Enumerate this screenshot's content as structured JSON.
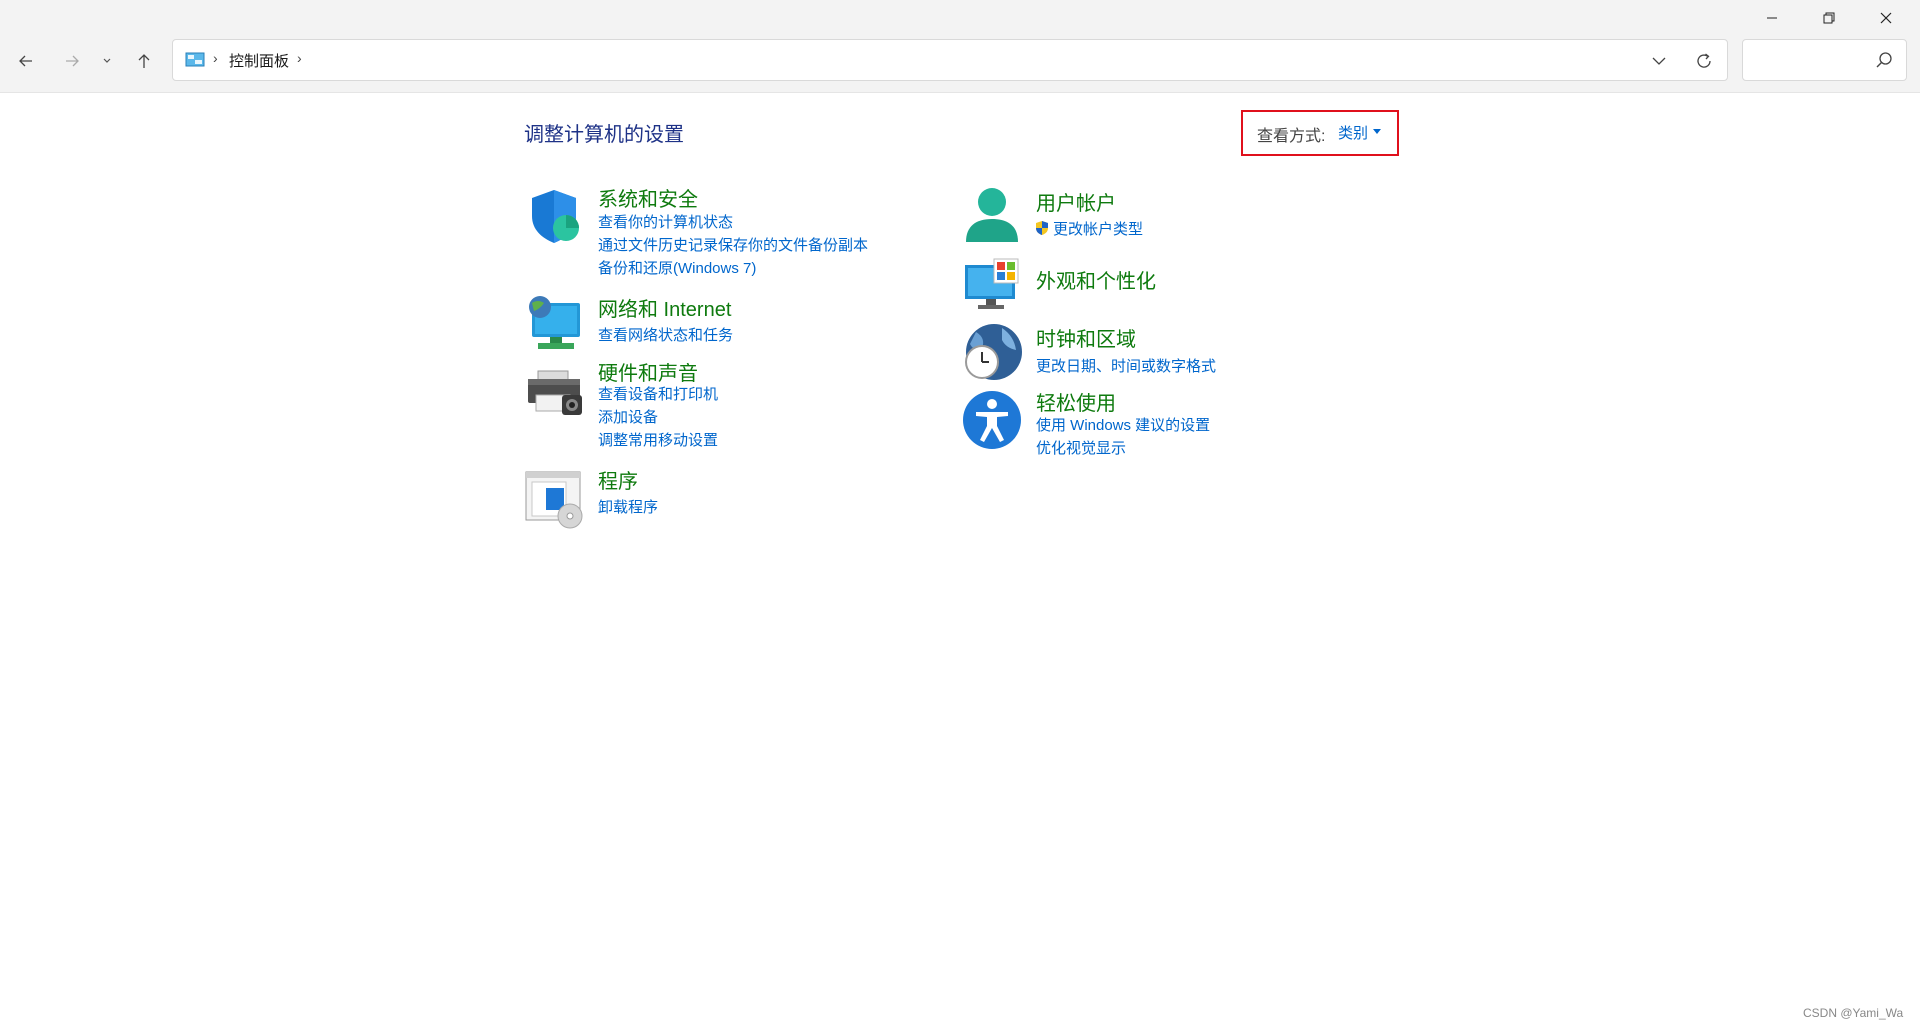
{
  "address_bar": {
    "breadcrumb": "控制面板",
    "search_placeholder": ""
  },
  "main": {
    "page_title": "调整计算机的设置",
    "view_by": {
      "label": "查看方式:",
      "value": "类别"
    }
  },
  "categories": {
    "system": {
      "title": "系统和安全",
      "links": [
        "查看你的计算机状态",
        "通过文件历史记录保存你的文件备份副本",
        "备份和还原(Windows 7)"
      ]
    },
    "network": {
      "title": "网络和 Internet",
      "links": [
        "查看网络状态和任务"
      ]
    },
    "hardware": {
      "title": "硬件和声音",
      "links": [
        "查看设备和打印机",
        "添加设备",
        "调整常用移动设置"
      ]
    },
    "programs": {
      "title": "程序",
      "links": [
        "卸载程序"
      ]
    },
    "users": {
      "title": "用户帐户",
      "links": [
        "更改帐户类型"
      ]
    },
    "appearance": {
      "title": "外观和个性化",
      "links": []
    },
    "clock": {
      "title": "时钟和区域",
      "links": [
        "更改日期、时间或数字格式"
      ]
    },
    "ease": {
      "title": "轻松使用",
      "links": [
        "使用 Windows 建议的设置",
        "优化视觉显示"
      ]
    }
  },
  "watermark": "CSDN @Yami_Wa",
  "colors": {
    "title_green": "#0e7a0e",
    "link_blue": "#0066cc",
    "page_title_blue": "#1e3287",
    "highlight_red": "#e0101c"
  }
}
